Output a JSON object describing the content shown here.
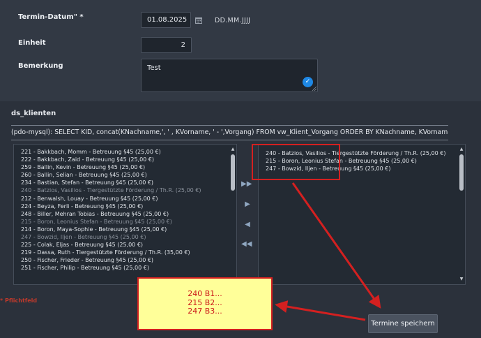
{
  "form": {
    "termin_datum_label": "Termin-Datum\" *",
    "termin_datum_value": "01.08.2025",
    "date_format_hint": "DD.MM.JJJJ",
    "einheit_label": "Einheit",
    "einheit_value": "2",
    "bemerkung_label": "Bemerkung",
    "bemerkung_value": "Test"
  },
  "clients": {
    "section_title": "ds_klienten",
    "sql": "(pdo-mysql): SELECT KID, concat(KNachname,', ' , KVorname, ' - ',Vorgang) FROM vw_Klient_Vorgang ORDER BY KNachname, KVorname, Vorgang",
    "available": [
      {
        "text": "221 - Bakkbach, Momm - Betreuung §45 (25,00 €)",
        "dim": false
      },
      {
        "text": "222 - Bakkbach, Zaid - Betreuung §45 (25,00 €)",
        "dim": false
      },
      {
        "text": "259 - Ballin, Kevin - Betreuung §45 (25,00 €)",
        "dim": false
      },
      {
        "text": "260 - Ballin, Selian - Betreuung §45 (25,00 €)",
        "dim": false
      },
      {
        "text": "234 - Bastian, Stefan - Betreuung §45 (25,00 €)",
        "dim": false
      },
      {
        "text": "240 - Batzios, Vasilios - Tiergestützte Förderung / Th.R. (25,00 €)",
        "dim": true
      },
      {
        "text": "212 - Benwalsh, Louay - Betreuung §45 (25,00 €)",
        "dim": false
      },
      {
        "text": "224 - Beyza, Ferli - Betreuung §45 (25,00 €)",
        "dim": false
      },
      {
        "text": "248 - Biller, Mehran Tobias - Betreuung §45 (25,00 €)",
        "dim": false
      },
      {
        "text": "215 - Boron, Leonius Stefan - Betreuung §45 (25,00 €)",
        "dim": true
      },
      {
        "text": "214 - Boron, Maya-Sophie - Betreuung §45 (25,00 €)",
        "dim": false
      },
      {
        "text": "247 - Bowzid, Iljen - Betreuung §45 (25,00 €)",
        "dim": true
      },
      {
        "text": "225 - Colak, Eljas - Betreuung §45 (25,00 €)",
        "dim": false
      },
      {
        "text": "219 - Dassa, Ruth - Tiergestützte Förderung / Th.R. (35,00 €)",
        "dim": false
      },
      {
        "text": "250 - Fischer, Frieder - Betreuung §45 (25,00 €)",
        "dim": false
      },
      {
        "text": "251 - Fischer, Philip - Betreuung §45 (25,00 €)",
        "dim": false
      }
    ],
    "selected": [
      {
        "text": "240 - Batzios, Vasilios - Tiergestützte Förderung / Th.R. (25,00 €)",
        "dim": false
      },
      {
        "text": "215 - Boron, Leonius Stefan - Betreuung §45 (25,00 €)",
        "dim": false
      },
      {
        "text": "247 - Bowzid, Iljen - Betreuung §45 (25,00 €)",
        "dim": false
      }
    ],
    "move_buttons": {
      "all_right": "▶▶",
      "right": "▶",
      "left": "◀",
      "all_left": "◀◀"
    }
  },
  "annotation": {
    "lines": [
      "240 B1...",
      "215 B2...",
      "247 B3..."
    ],
    "accent_color": "#d42020",
    "note_bg": "#ffff99"
  },
  "required_note": "* Pflichtfeld",
  "save_button_label": "Termine speichern",
  "icons": {
    "calendar": "calendar-icon",
    "check": "check-icon"
  }
}
